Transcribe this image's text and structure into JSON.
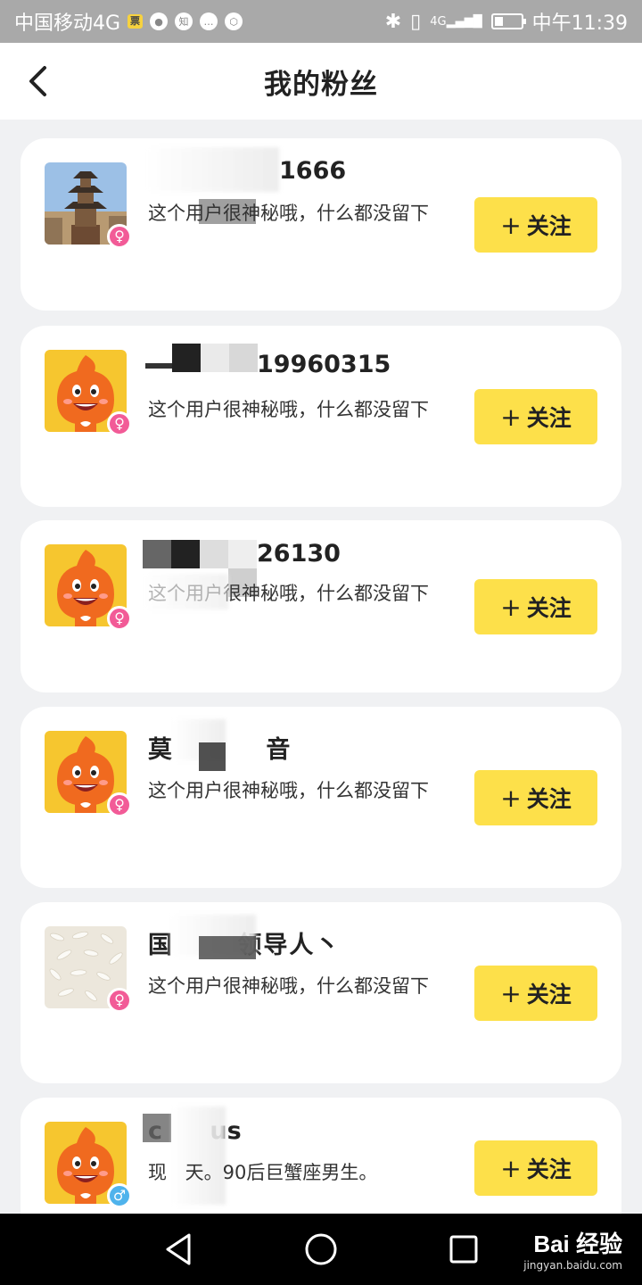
{
  "status_bar": {
    "carrier": "中国移动4G",
    "time": "中午11:39",
    "network": "4G"
  },
  "header": {
    "title": "我的粉丝"
  },
  "fans": [
    {
      "name": "1666",
      "bio": "这个用户很神秘哦，什么都没留下",
      "gender": "female",
      "follow_label": "关注",
      "avatar": "pagoda-photo"
    },
    {
      "name": "19960315",
      "bio": "这个用户很神秘哦，什么都没留下",
      "gender": "female",
      "follow_label": "关注",
      "avatar": "orange-mascot"
    },
    {
      "name": "26130",
      "bio": "这个用户很神秘哦，什么都没留下",
      "gender": "female",
      "follow_label": "关注",
      "avatar": "orange-mascot"
    },
    {
      "name": "莫 音",
      "bio": "这个用户很神秘哦，什么都没留下",
      "gender": "female",
      "follow_label": "关注",
      "avatar": "orange-mascot"
    },
    {
      "name": "国 领导人丶",
      "bio": "这个用户很神秘哦，什么都没留下",
      "gender": "female",
      "follow_label": "关注",
      "avatar": "rice-photo"
    },
    {
      "name": "c us",
      "bio": "现 天。90后巨蟹座男生。",
      "gender": "male",
      "follow_label": "关注",
      "avatar": "orange-mascot"
    }
  ],
  "watermark": {
    "logo": "Bai 经验",
    "url": "jingyan.baidu.com"
  },
  "colors": {
    "follow_button": "#fde04a",
    "female_badge": "#f25b97",
    "male_badge": "#4fb3ec",
    "background": "#f0f1f3"
  }
}
